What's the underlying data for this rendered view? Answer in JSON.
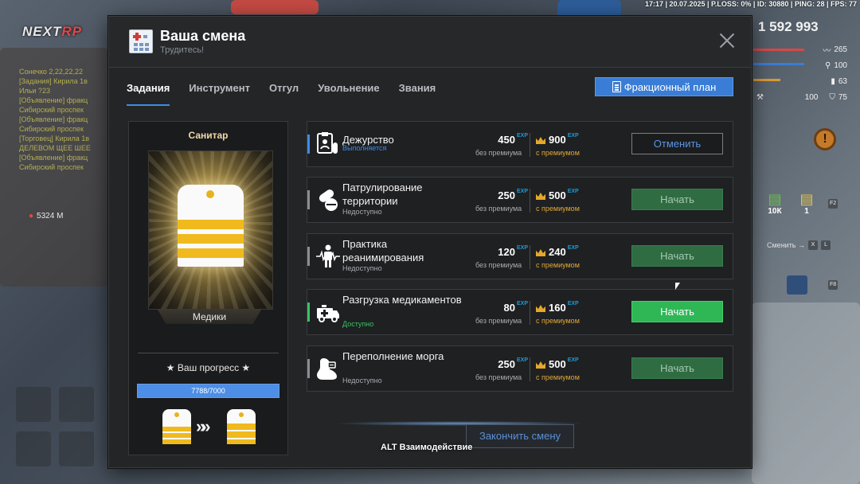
{
  "hud": {
    "status_bar": "17:17 | 20.07.2025 | P.LOSS: 0% | ID: 30880 | PING: 28 | FPS: 77",
    "logo_left": "NEXT",
    "logo_right": "RP",
    "money": "1 592 993",
    "stats": [
      {
        "icon": "heartbeat-icon",
        "value": "265"
      },
      {
        "icon": "food-icon",
        "value": "100"
      },
      {
        "icon": "ammo-icon",
        "value": "63"
      },
      {
        "icon": "armor-icon",
        "value": "75"
      }
    ],
    "stat_small": "100",
    "distance": "5324 M",
    "cash_items": [
      {
        "icon": "cash-stack-icon",
        "value": "10К"
      },
      {
        "icon": "cash-pile-icon",
        "value": "1"
      }
    ],
    "switch_label": "Сменить →",
    "switch_keys": [
      "X",
      "L"
    ],
    "hotkeys": [
      "F2",
      "F8"
    ],
    "chat_lines": [
      "Сонечко 2,22,22,22",
      "[Задания] Кирила 1в",
      "Ильи ?23",
      "[Объявление] фракц",
      "Сибирский проспек",
      "[Объявление] фракц",
      "Сибирский проспек",
      "[Торговец] Кирила 1в",
      "ДЕЛЕВОМ ЩЕЕ ШЕЕ",
      "[Объявление] фракц",
      "Сибирский проспек"
    ]
  },
  "window": {
    "title": "Ваша смена",
    "subtitle": "Трудитесь!",
    "tabs": [
      "Задания",
      "Инструмент",
      "Отгул",
      "Увольнение",
      "Звания"
    ],
    "active_tab": 0,
    "plan_button": "Фракционный план"
  },
  "rank": {
    "name": "Санитар",
    "faction": "Медики",
    "progress_title": "★ Ваш прогресс ★",
    "progress_current": 7788,
    "progress_max": 7000,
    "progress_text": "7788/7000",
    "next_arrows": "»"
  },
  "tasks": [
    {
      "name": "Дежурство",
      "status": "Выполняется",
      "status_color": "#3d8ce8",
      "exp_base": "450",
      "exp_premium": "900",
      "action": "Отменить",
      "action_state": "cancel",
      "accent": "#3d8ce8",
      "icon": "clipboard-icon"
    },
    {
      "name": "Патрулирование территории",
      "status": "Недоступно",
      "status_color": "#a7abb0",
      "exp_base": "250",
      "exp_premium": "500",
      "action": "Начать",
      "action_state": "disabled",
      "accent": "#8a8e94",
      "icon": "pills-icon"
    },
    {
      "name": "Практика реанимирования",
      "status": "Недоступно",
      "status_color": "#a7abb0",
      "exp_base": "120",
      "exp_premium": "240",
      "action": "Начать",
      "action_state": "disabled",
      "accent": "#8a8e94",
      "icon": "heartbeat-person-icon"
    },
    {
      "name": "Разгрузка медикаментов",
      "status": "Доступно",
      "status_color": "#36c463",
      "exp_base": "80",
      "exp_premium": "160",
      "action": "Начать",
      "action_state": "enabled",
      "accent": "#36c463",
      "icon": "ambulance-icon"
    },
    {
      "name": "Переполнение морга",
      "status": "Недоступно",
      "status_color": "#a7abb0",
      "exp_base": "250",
      "exp_premium": "500",
      "action": "Начать",
      "action_state": "disabled",
      "accent": "#8a8e94",
      "icon": "morgue-foot-icon"
    }
  ],
  "labels": {
    "exp": "EXP",
    "without_premium": "без премиума",
    "with_premium": "с премиумом"
  },
  "finish_button": "Закончить смену",
  "interaction_hint": "ALT Взаимодействие"
}
